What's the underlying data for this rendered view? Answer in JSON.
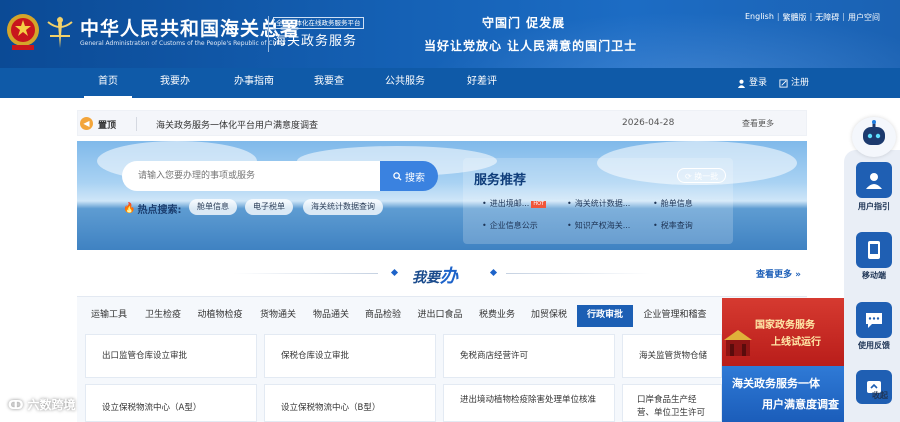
{
  "header": {
    "site_name": "中华人民共和国海关总署",
    "site_name_en": "General Administration of Customs of the People's Republic of China",
    "platform_tag": "全国一体化在线政务服务平台",
    "platform_name": "海关政务服务",
    "slogan_line1": "守国门  促发展",
    "slogan_line2": "当好让党放心  让人民满意的国门卫士",
    "top_links": [
      "English",
      "繁體版",
      "无障碍",
      "用户空间"
    ]
  },
  "nav": {
    "items": [
      "首页",
      "我要办",
      "办事指南",
      "我要查",
      "公共服务",
      "好差评"
    ],
    "active": "首页",
    "login": "登录",
    "register": "注册"
  },
  "notice": {
    "label": "置顶",
    "text": "海关政务服务一体化平台用户满意度调查",
    "date": "2026-04-28",
    "more": "查看更多"
  },
  "search": {
    "placeholder": "请输入您要办理的事项或服务",
    "button": "搜索",
    "hot_label": "热点搜索:",
    "hot_tags": [
      "舱单信息",
      "电子税单",
      "海关统计数据查询"
    ]
  },
  "recommend": {
    "title": "服务推荐",
    "refresh": "换一批",
    "items": [
      "进出境邮...",
      "海关统计数据...",
      "舱单信息",
      "企业信息公示",
      "知识产权海关...",
      "税率查询"
    ],
    "hot_badge": "HOT"
  },
  "section": {
    "title_prefix": "我要",
    "title_main": "办",
    "view_more": "查看更多"
  },
  "categories": {
    "items": [
      "运输工具",
      "卫生检疫",
      "动植物检疫",
      "货物通关",
      "物品通关",
      "商品检验",
      "进出口食品",
      "税费业务",
      "加贸保税",
      "行政审批",
      "企业管理和稽查"
    ],
    "active": "行政审批"
  },
  "cards": [
    "出口监管仓库设立审批",
    "保税仓库设立审批",
    "免税商店经营许可",
    "海关监管货物仓储",
    "设立保税物流中心（A型）",
    "设立保税物流中心（B型）",
    "进出境动植物检疫除害处理单位核准",
    "口岸食品生产经营、单位卫生许可"
  ],
  "promo": {
    "line1": "国家政务服务",
    "line2": "上线试运行",
    "line3": "海关政务服务一体",
    "line4": "用户满意度调查"
  },
  "sidebar": {
    "items": [
      "用户指引",
      "移动端",
      "使用反馈",
      "收起"
    ]
  },
  "watermark": "六数跨境",
  "colors": {
    "header_blue": "#0b4a95",
    "nav_blue": "#0f5aa8",
    "accent_blue": "#1c5fb4",
    "hot_red": "#f1563a"
  }
}
